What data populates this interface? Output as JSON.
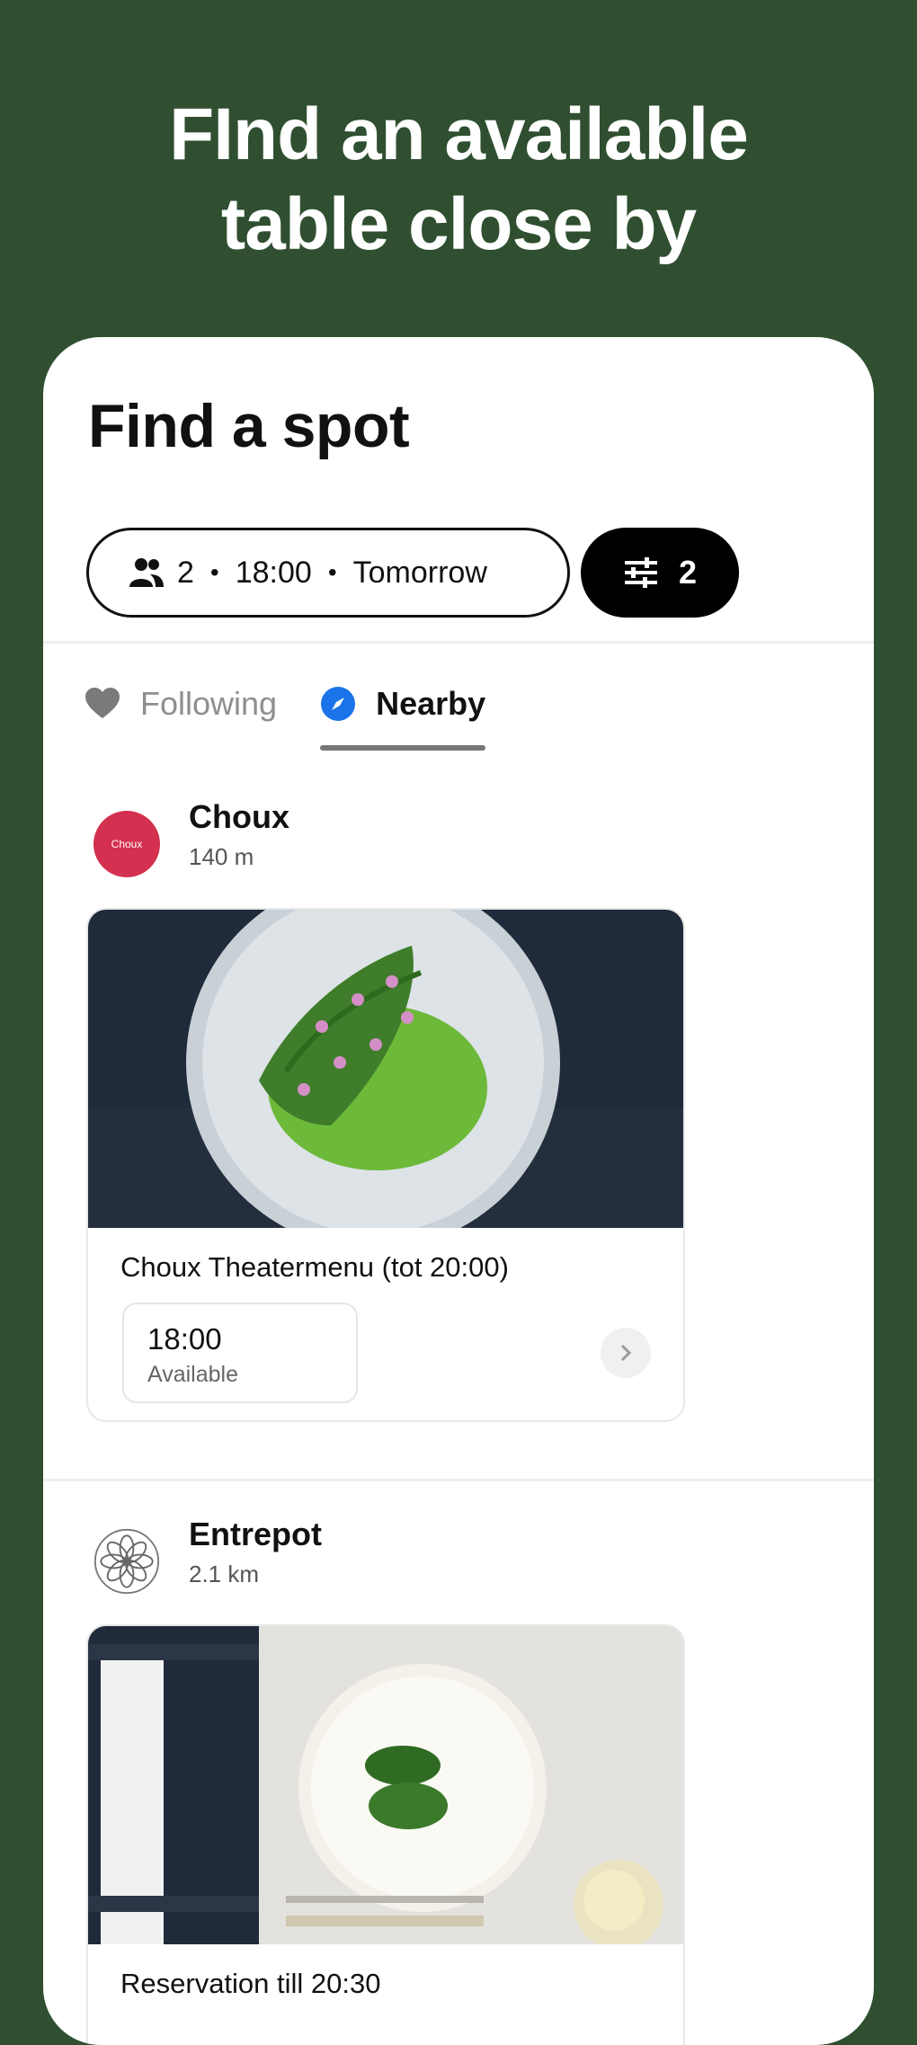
{
  "headline": {
    "line1": "FInd an available",
    "line2": "table close by"
  },
  "screen": {
    "title": "Find a spot",
    "search_pill": {
      "guests": "2",
      "time": "18:00",
      "day": "Tomorrow"
    },
    "filter_count": "2",
    "tabs": [
      {
        "label": "Following",
        "icon": "heart-icon",
        "selected": false
      },
      {
        "label": "Nearby",
        "icon": "compass-icon",
        "selected": true
      }
    ]
  },
  "restaurants": [
    {
      "name": "Choux",
      "distance": "140 m",
      "logo_text": "Choux",
      "offer": {
        "name": "Choux Theatermenu (tot 20:00)",
        "slot_time": "18:00",
        "slot_status": "Available"
      }
    },
    {
      "name": "Entrepot",
      "distance": "2.1 km",
      "offer": {
        "name": "Reservation till 20:30"
      }
    }
  ],
  "colors": {
    "background": "#2f4f30",
    "accent": "#1a73e8",
    "logo_choux": "#d4304f"
  }
}
